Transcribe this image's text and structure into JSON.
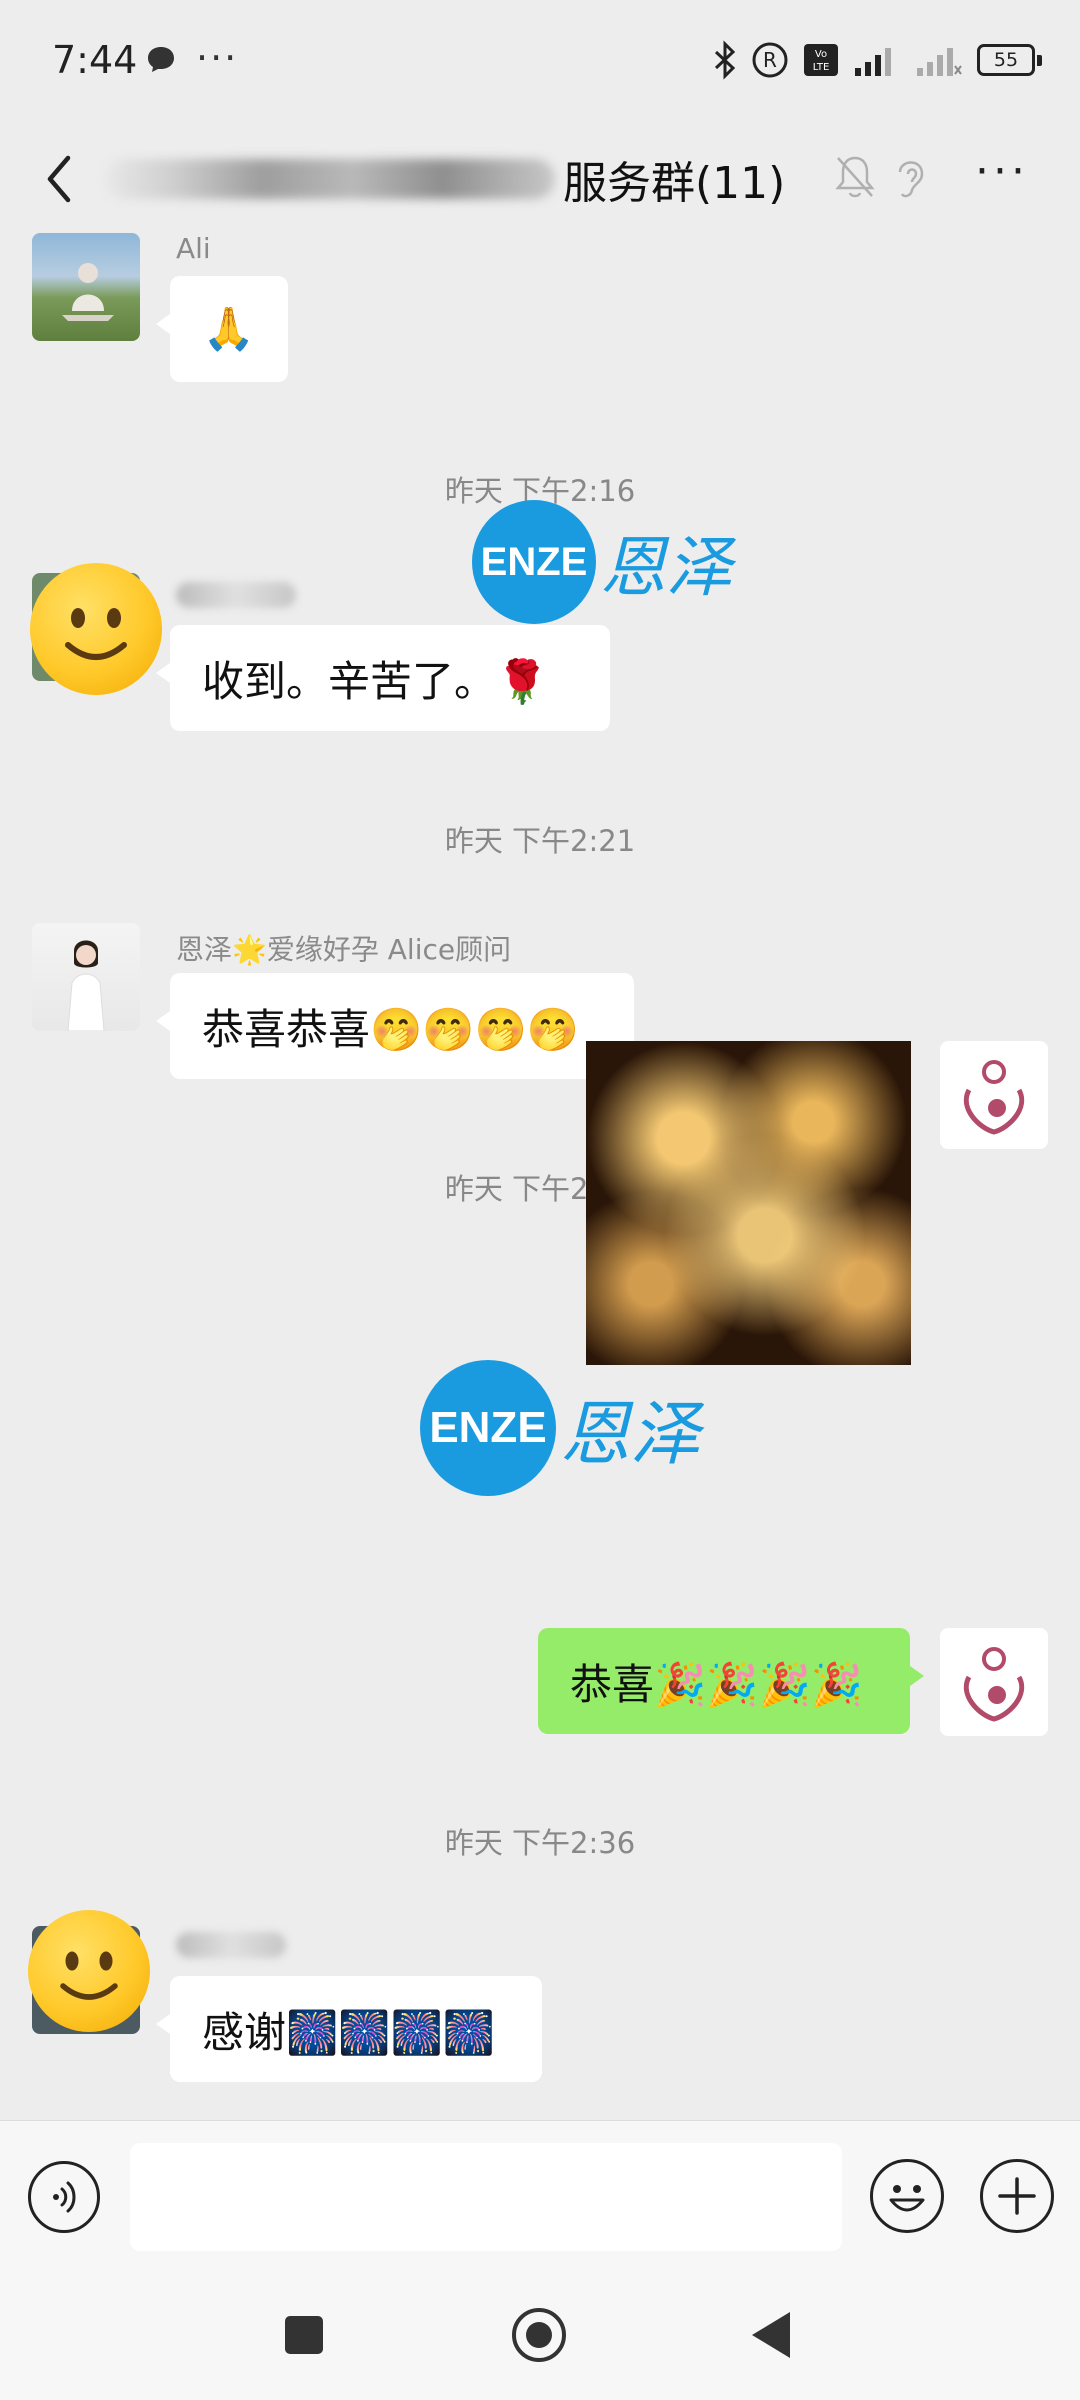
{
  "status_bar": {
    "time": "7:44",
    "battery": "55",
    "icons": [
      "chat-bubble-icon",
      "more-dots-icon",
      "bluetooth-icon",
      "registered-icon",
      "volte-icon",
      "signal-icon",
      "signal-weak-icon",
      "battery-icon"
    ]
  },
  "header": {
    "title_visible": "服务群(11)",
    "more_label": "···"
  },
  "messages": [
    {
      "sender": "Ali",
      "text": "🙏",
      "side": "left"
    },
    {
      "timestamp": "昨天 下午2:16"
    },
    {
      "sender": "",
      "text": "收到。辛苦了。🌹",
      "side": "left"
    },
    {
      "timestamp": "昨天 下午2:21"
    },
    {
      "sender": "恩泽🌟爱缘好孕 Alice顾问",
      "text": "恭喜恭喜🤭🤭🤭🤭",
      "side": "left"
    },
    {
      "timestamp": "昨天 下午2:30"
    },
    {
      "type": "image",
      "description": "fireworks",
      "side": "right"
    },
    {
      "text": "恭喜🎉🎉🎉🎉",
      "side": "right"
    },
    {
      "timestamp": "昨天 下午2:36"
    },
    {
      "sender": "",
      "text": "感谢🎆🎆🎆🎆",
      "side": "left"
    }
  ],
  "watermark": {
    "en": "ENZE",
    "cn": "恩泽"
  },
  "input": {
    "value": "",
    "placeholder": ""
  },
  "colors": {
    "accent": "#95ec69",
    "watermark": "#1a9be0",
    "background": "#ededed"
  }
}
